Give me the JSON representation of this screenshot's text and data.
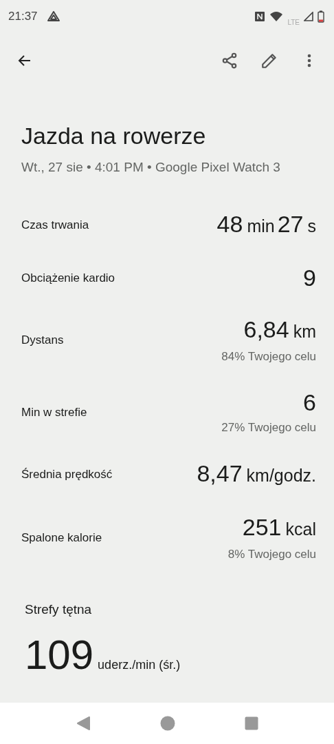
{
  "status_bar": {
    "time": "21:37",
    "lte": "LTE"
  },
  "title": "Jazda na rowerze",
  "subtitle": "Wt., 27 sie • 4:01 PM • Google Pixel Watch 3",
  "metrics": [
    {
      "label": "Czas trwania",
      "value": [
        {
          "kind": "number",
          "text": "48"
        },
        {
          "kind": "unit",
          "text": "min"
        },
        {
          "kind": "number",
          "text": "27"
        },
        {
          "kind": "unit",
          "text": "s"
        }
      ]
    },
    {
      "label": "Obciążenie kardio",
      "value": [
        {
          "kind": "number",
          "text": "9"
        }
      ]
    },
    {
      "label": "Dystans",
      "value": [
        {
          "kind": "number",
          "text": "6,84"
        },
        {
          "kind": "unit",
          "text": "km"
        }
      ],
      "goal": "84% Twojego celu"
    },
    {
      "label": "Min w strefie",
      "value": [
        {
          "kind": "number",
          "text": "6"
        }
      ],
      "goal": "27% Twojego celu"
    },
    {
      "label": "Średnia prędkość",
      "value": [
        {
          "kind": "number",
          "text": "8,47"
        },
        {
          "kind": "unit",
          "text": "km/godz."
        }
      ]
    },
    {
      "label": "Spalone kalorie",
      "value": [
        {
          "kind": "number",
          "text": "251"
        },
        {
          "kind": "unit",
          "text": "kcal"
        }
      ],
      "goal": "8% Twojego celu"
    }
  ],
  "heart_zones": {
    "title": "Strefy tętna",
    "value": "109",
    "unit": "uderz./min (śr.)"
  }
}
